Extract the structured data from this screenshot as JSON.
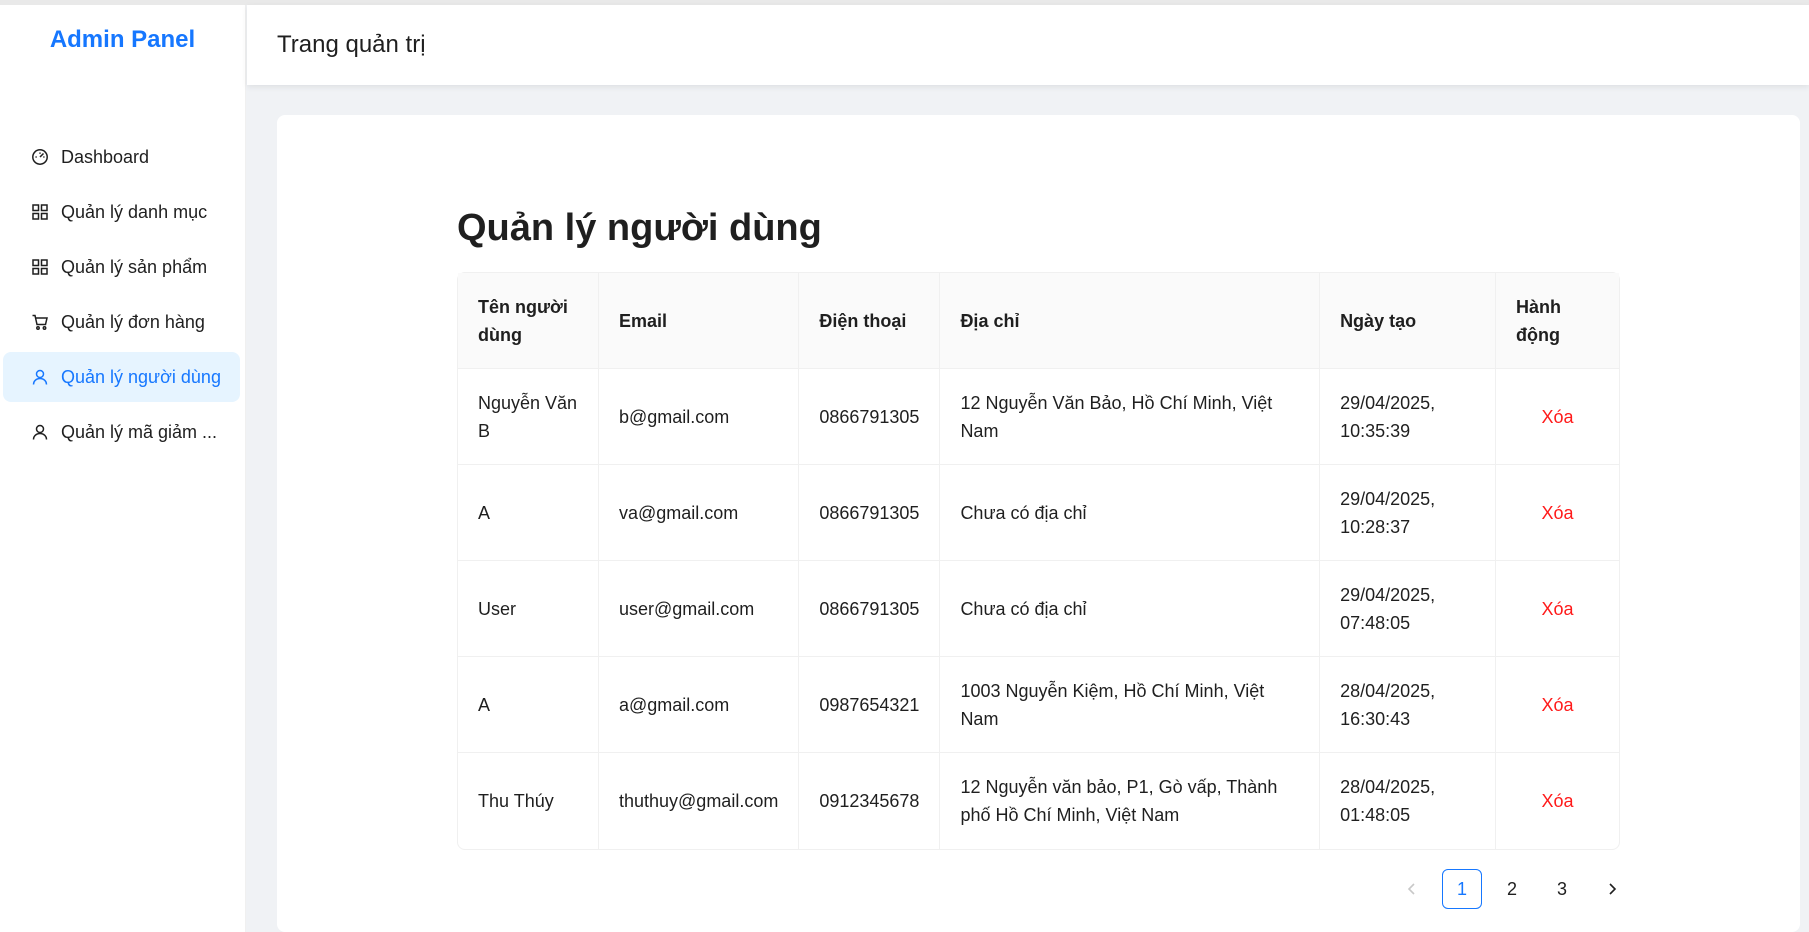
{
  "sidebar": {
    "brand": "Admin Panel",
    "items": [
      {
        "label": "Dashboard",
        "icon": "dashboard-icon"
      },
      {
        "label": "Quản lý danh mục",
        "icon": "grid-icon"
      },
      {
        "label": "Quản lý sản phẩm",
        "icon": "grid-icon"
      },
      {
        "label": "Quản lý đơn hàng",
        "icon": "cart-icon"
      },
      {
        "label": "Quản lý người dùng",
        "icon": "user-icon",
        "active": true
      },
      {
        "label": "Quản lý mã giảm ...",
        "icon": "user-icon"
      }
    ]
  },
  "header": {
    "title": "Trang quản trị"
  },
  "main": {
    "title": "Quản lý người dùng",
    "columns": [
      "Tên người dùng",
      "Email",
      "Điện thoại",
      "Địa chỉ",
      "Ngày tạo",
      "Hành động"
    ],
    "rows": [
      {
        "name": "Nguyễn Văn B",
        "email": "b@gmail.com",
        "phone": "0866791305",
        "address": "12 Nguyễn Văn Bảo, Hồ Chí Minh, Việt Nam",
        "created": "29/04/2025, 10:35:39",
        "action": "Xóa"
      },
      {
        "name": "A",
        "email": "va@gmail.com",
        "phone": "0866791305",
        "address": "Chưa có địa chỉ",
        "created": "29/04/2025, 10:28:37",
        "action": "Xóa"
      },
      {
        "name": "User",
        "email": "user@gmail.com",
        "phone": "0866791305",
        "address": "Chưa có địa chỉ",
        "created": "29/04/2025, 07:48:05",
        "action": "Xóa"
      },
      {
        "name": "A",
        "email": "a@gmail.com",
        "phone": "0987654321",
        "address": "1003 Nguyễn Kiệm, Hồ Chí Minh, Việt Nam",
        "created": "28/04/2025, 16:30:43",
        "action": "Xóa"
      },
      {
        "name": "Thu Thúy",
        "email": "thuthuy@gmail.com",
        "phone": "0912345678",
        "address": "12 Nguyễn văn bảo, P1, Gò vấp, Thành phố Hồ Chí Minh, Việt Nam",
        "created": "28/04/2025, 01:48:05",
        "action": "Xóa"
      }
    ],
    "pagination": {
      "pages": [
        "1",
        "2",
        "3"
      ],
      "current": "1"
    }
  },
  "colors": {
    "accent": "#1677ff",
    "danger": "#ff1a1a"
  }
}
